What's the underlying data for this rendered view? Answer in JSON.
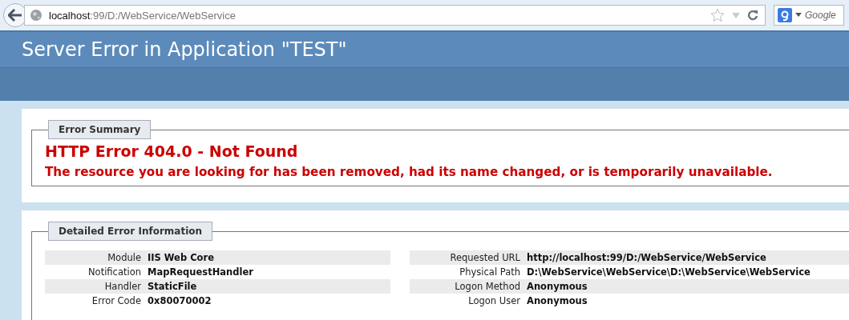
{
  "browser": {
    "url_host": "localhost",
    "url_rest": ":99/D:/WebService/WebService",
    "search_placeholder": "Google"
  },
  "header": {
    "title": "Server Error in Application \"TEST\""
  },
  "summary": {
    "legend": "Error Summary",
    "heading": "HTTP Error 404.0 - Not Found",
    "message": "The resource you are looking for has been removed, had its name changed, or is temporarily unavailable."
  },
  "details": {
    "legend": "Detailed Error Information",
    "left": [
      {
        "label": "Module",
        "value": "IIS Web Core"
      },
      {
        "label": "Notification",
        "value": "MapRequestHandler"
      },
      {
        "label": "Handler",
        "value": "StaticFile"
      },
      {
        "label": "Error Code",
        "value": "0x80070002"
      }
    ],
    "right": [
      {
        "label": "Requested URL",
        "value": "http://localhost:99/D:/WebService/WebService"
      },
      {
        "label": "Physical Path",
        "value": "D:\\WebService\\WebService\\D:\\WebService\\WebService"
      },
      {
        "label": "Logon Method",
        "value": "Anonymous"
      },
      {
        "label": "Logon User",
        "value": "Anonymous"
      }
    ]
  }
}
